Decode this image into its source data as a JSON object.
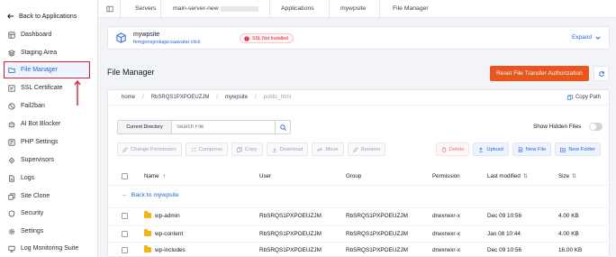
{
  "sidebar": {
    "back_label": "Back to Applications",
    "items": [
      {
        "label": "Dashboard",
        "icon": "dashboard-icon"
      },
      {
        "label": "Staging Area",
        "icon": "layers-icon"
      },
      {
        "label": "File Manager",
        "icon": "folder-icon",
        "active": true
      },
      {
        "label": "SSL Certificate",
        "icon": "certificate-icon"
      },
      {
        "label": "Fail2ban",
        "icon": "ban-icon"
      },
      {
        "label": "AI Bot Blocker",
        "icon": "bot-icon"
      },
      {
        "label": "PHP Settings",
        "icon": "php-icon"
      },
      {
        "label": "Supervisors",
        "icon": "supervisor-icon"
      },
      {
        "label": "Logs",
        "icon": "logs-icon"
      },
      {
        "label": "Site Clone",
        "icon": "clone-icon"
      },
      {
        "label": "Security",
        "icon": "shield-icon"
      },
      {
        "label": "Settings",
        "icon": "gear-icon"
      },
      {
        "label": "Log Monitoring Suite",
        "icon": "monitor-icon"
      }
    ]
  },
  "topbar": {
    "crumbs": [
      "Servers",
      "main-server-new",
      "Applications",
      "mywpsite",
      "File Manager"
    ]
  },
  "site": {
    "name": "mywpsite",
    "url": "femgonsjcnkajw.saavatar.click",
    "ssl_status": "SSL Not Installed",
    "expand_label": "Expand"
  },
  "file_manager": {
    "title": "File Manager",
    "reset_label": "Reset File Transfer Authorization",
    "path": [
      "home",
      "RbSRQS1PXPOEUZJM",
      "mywpsite",
      "public_html"
    ],
    "copy_path_label": "Copy Path",
    "directory_select": "Current Directory",
    "search_placeholder": "Search File",
    "show_hidden_label": "Show Hidden Files",
    "actions_left": [
      "Change Permission",
      "Compress",
      "Copy",
      "Download",
      "Move",
      "Rename"
    ],
    "actions_right": [
      "Delete",
      "Upload",
      "New File",
      "New Folder"
    ],
    "columns": [
      "Name",
      "User",
      "Group",
      "Permission",
      "Last modified",
      "Size"
    ],
    "back_link": "Back to mywpsite",
    "rows": [
      {
        "name": "wp-admin",
        "user": "RbSRQS1PXPOEUZJM",
        "group": "RbSRQS1PXPOEUZJM",
        "permission": "drwxrwxr-x",
        "modified": "Dec 09 10:56",
        "size": "4.00 KB"
      },
      {
        "name": "wp-content",
        "user": "RbSRQS1PXPOEUZJM",
        "group": "RbSRQS1PXPOEUZJM",
        "permission": "drwxrwxr-x",
        "modified": "Jan 08 10:44",
        "size": "4.00 KB"
      },
      {
        "name": "wp-includes",
        "user": "RbSRQS1PXPOEUZJM",
        "group": "RbSRQS1PXPOEUZJM",
        "permission": "drwxrwxr-x",
        "modified": "Dec 09 10:56",
        "size": "16.00 KB"
      }
    ]
  },
  "colors": {
    "accent": "#2563eb",
    "reset_button": "#e8551d",
    "highlight": "#e11d2e"
  }
}
